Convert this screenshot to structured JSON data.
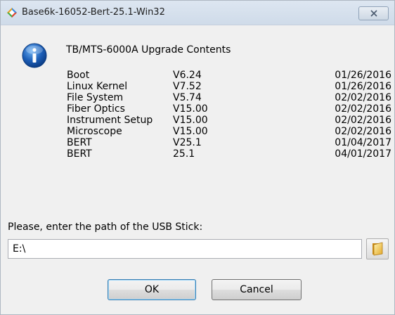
{
  "window": {
    "title": "Base6k-16052-Bert-25.1-Win32",
    "colors": {
      "titlebar": "#d6e1ee",
      "background": "#f0f0f0",
      "info_icon": "#1d5fb8"
    }
  },
  "dialog": {
    "icon": "info-icon",
    "heading": "TB/MTS-6000A Upgrade Contents",
    "items": [
      {
        "name": "Boot",
        "version": "V6.24",
        "date": "01/26/2016"
      },
      {
        "name": "Linux Kernel",
        "version": "V7.52",
        "date": "01/26/2016"
      },
      {
        "name": "File System",
        "version": "V5.74",
        "date": "02/02/2016"
      },
      {
        "name": "Fiber Optics",
        "version": "V15.00",
        "date": "02/02/2016"
      },
      {
        "name": "Instrument Setup",
        "version": "V15.00",
        "date": "02/02/2016"
      },
      {
        "name": "Microscope",
        "version": "V15.00",
        "date": "02/02/2016"
      },
      {
        "name": "BERT",
        "version": "V25.1",
        "date": "01/04/2017"
      },
      {
        "name": "BERT",
        "version": "25.1",
        "date": "04/01/2017"
      }
    ],
    "path_label": "Please, enter the path of the USB Stick:",
    "path_value": "E:\\",
    "browse_icon": "folder-icon",
    "ok_label": "OK",
    "cancel_label": "Cancel"
  }
}
